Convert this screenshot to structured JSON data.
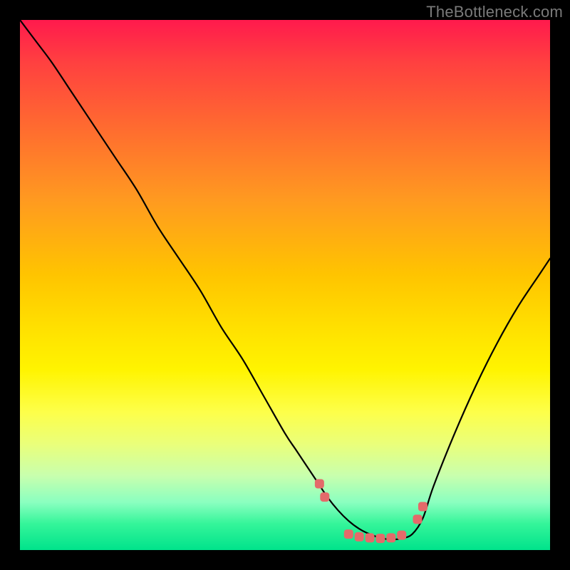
{
  "watermark": "TheBottleneck.com",
  "colors": {
    "frame": "#000000",
    "curve": "#000000",
    "markers": "#e46a6a",
    "gradient_top": "#ff1a4d",
    "gradient_bottom": "#00e38b"
  },
  "chart_data": {
    "type": "line",
    "title": "",
    "xlabel": "",
    "ylabel": "",
    "xlim": [
      0,
      100
    ],
    "ylim": [
      0,
      100
    ],
    "series": [
      {
        "name": "bottleneck-curve",
        "x": [
          0,
          3,
          6,
          10,
          14,
          18,
          22,
          26,
          30,
          34,
          38,
          42,
          46,
          50,
          52,
          54,
          56,
          58,
          60,
          62,
          64,
          66,
          68,
          70,
          72,
          74,
          76,
          78,
          82,
          86,
          90,
          94,
          98,
          100
        ],
        "y": [
          100,
          96,
          92,
          86,
          80,
          74,
          68,
          61,
          55,
          49,
          42,
          36,
          29,
          22,
          19,
          16,
          13,
          10,
          7.5,
          5.5,
          4,
          3,
          2.3,
          2,
          2.2,
          3,
          6,
          12,
          22,
          31,
          39,
          46,
          52,
          55
        ]
      }
    ],
    "markers": {
      "name": "highlight-dots",
      "points": [
        {
          "x": 56.5,
          "y": 12.5
        },
        {
          "x": 57.5,
          "y": 10.0
        },
        {
          "x": 62.0,
          "y": 3.0
        },
        {
          "x": 64.0,
          "y": 2.5
        },
        {
          "x": 66.0,
          "y": 2.3
        },
        {
          "x": 68.0,
          "y": 2.2
        },
        {
          "x": 70.0,
          "y": 2.3
        },
        {
          "x": 72.0,
          "y": 2.8
        },
        {
          "x": 75.0,
          "y": 5.8
        },
        {
          "x": 76.0,
          "y": 8.2
        }
      ]
    }
  }
}
